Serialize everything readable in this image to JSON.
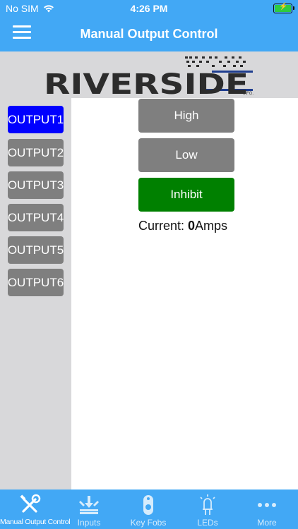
{
  "status": {
    "carrier": "No SIM",
    "time": "4:26 PM"
  },
  "nav": {
    "title": "Manual Output Control"
  },
  "logo": {
    "text": "RIVERSIDE",
    "suffix": "MFG."
  },
  "outputs": [
    {
      "label": "OUTPUT1",
      "active": true
    },
    {
      "label": "OUTPUT2",
      "active": false
    },
    {
      "label": "OUTPUT3",
      "active": false
    },
    {
      "label": "OUTPUT4",
      "active": false
    },
    {
      "label": "OUTPUT5",
      "active": false
    },
    {
      "label": "OUTPUT6",
      "active": false
    }
  ],
  "controls": {
    "high": "High",
    "low": "Low",
    "inhibit": "Inhibit",
    "current_label": "Current: ",
    "current_value": "0",
    "current_unit": "Amps"
  },
  "tabs": [
    {
      "label": "Manual Output Control",
      "icon": "tools-icon",
      "active": true
    },
    {
      "label": "Inputs",
      "icon": "inputs-icon",
      "active": false
    },
    {
      "label": "Key Fobs",
      "icon": "key-fob-icon",
      "active": false
    },
    {
      "label": "LEDs",
      "icon": "led-icon",
      "active": false
    },
    {
      "label": "More",
      "icon": "more-icon",
      "active": false
    }
  ],
  "colors": {
    "header": "#42a8f5",
    "active_output": "#0000ff",
    "button_gray": "#7f7f7f",
    "inhibit_green": "#008000",
    "sidebar_gray": "#d8d8da"
  }
}
